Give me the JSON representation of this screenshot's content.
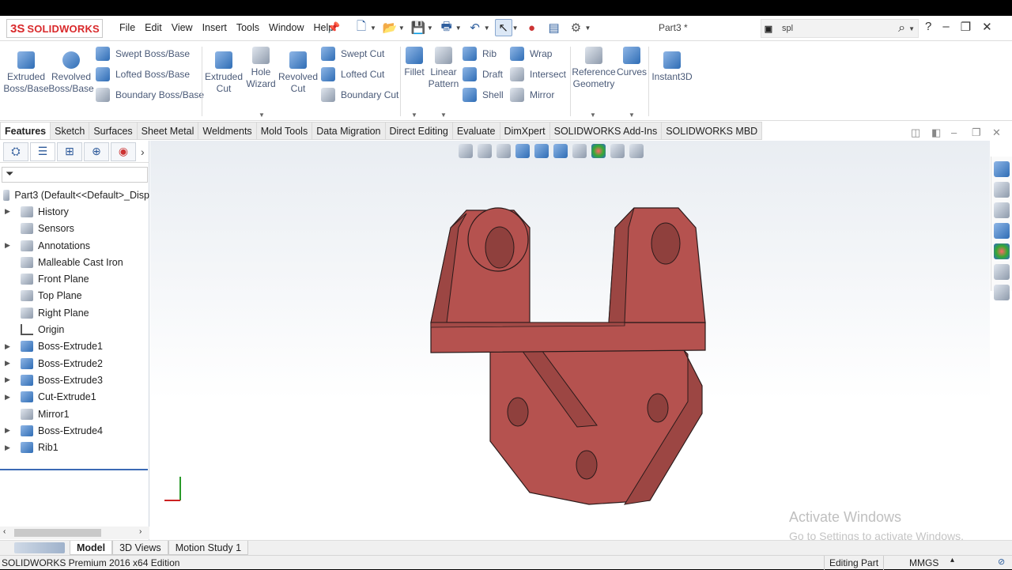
{
  "app": {
    "logo_mark": "3S",
    "logo_text": "SOLIDWORKS",
    "document_title": "Part3 *"
  },
  "menu": [
    "File",
    "Edit",
    "View",
    "Insert",
    "Tools",
    "Window",
    "Help"
  ],
  "search": {
    "value": "spl"
  },
  "toolbar": {
    "extruded_boss": "Extruded\nBoss/Base",
    "revolved_boss": "Revolved\nBoss/Base",
    "swept_boss": "Swept Boss/Base",
    "lofted_boss": "Lofted Boss/Base",
    "boundary_boss": "Boundary Boss/Base",
    "extruded_cut": "Extruded\nCut",
    "hole_wizard": "Hole\nWizard",
    "revolved_cut": "Revolved\nCut",
    "swept_cut": "Swept Cut",
    "lofted_cut": "Lofted Cut",
    "boundary_cut": "Boundary Cut",
    "fillet": "Fillet",
    "linear_pattern": "Linear\nPattern",
    "rib": "Rib",
    "draft": "Draft",
    "shell": "Shell",
    "wrap": "Wrap",
    "intersect": "Intersect",
    "mirror": "Mirror",
    "reference_geometry": "Reference\nGeometry",
    "curves": "Curves",
    "instant3d": "Instant3D"
  },
  "tabs": [
    "Features",
    "Sketch",
    "Surfaces",
    "Sheet Metal",
    "Weldments",
    "Mold Tools",
    "Data Migration",
    "Direct Editing",
    "Evaluate",
    "DimXpert",
    "SOLIDWORKS Add-Ins",
    "SOLIDWORKS MBD"
  ],
  "tree": {
    "root": "Part3  (Default<<Default>_Disp",
    "items": [
      "History",
      "Sensors",
      "Annotations",
      "Malleable Cast Iron",
      "Front Plane",
      "Top Plane",
      "Right Plane",
      "Origin",
      "Boss-Extrude1",
      "Boss-Extrude2",
      "Boss-Extrude3",
      "Cut-Extrude1",
      "Mirror1",
      "Boss-Extrude4",
      "Rib1"
    ]
  },
  "bottom_tabs": [
    "Model",
    "3D Views",
    "Motion Study 1"
  ],
  "watermark": {
    "line1": "Activate Windows",
    "line2": "Go to Settings to activate Windows."
  },
  "status": {
    "edition": "SOLIDWORKS Premium 2016 x64 Edition",
    "mode": "Editing Part",
    "units": "MMGS"
  },
  "colors": {
    "part_face": "#b5524f",
    "part_dark": "#9c4643",
    "accent": "#3b6ab5",
    "brand": "#d9292b"
  }
}
